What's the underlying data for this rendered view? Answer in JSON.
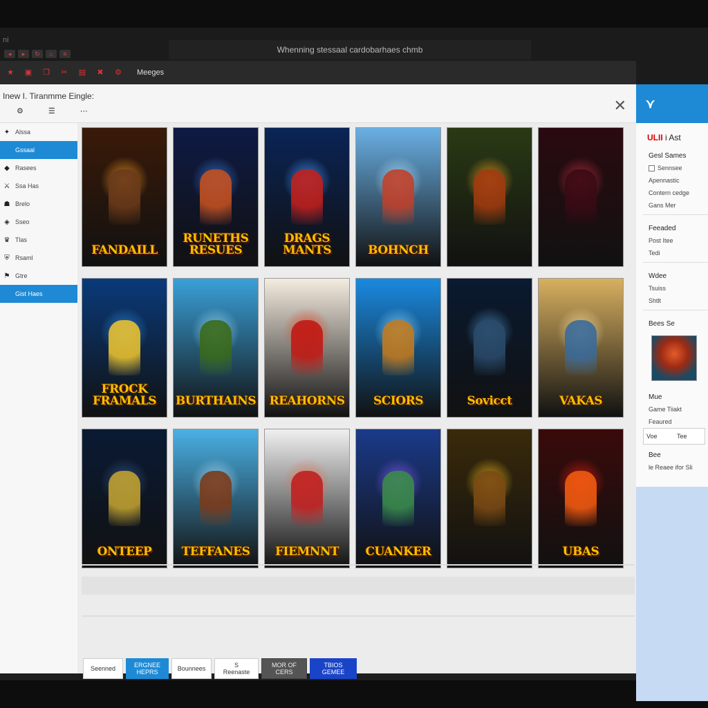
{
  "browser": {
    "url_text": "Whenning stessaal cardobarhaes chmb",
    "toolbar_label": "Meeges",
    "logo_text": "ni"
  },
  "window": {
    "title": "Inew I. Tiranmme Eingle:",
    "close_symbol": "✕"
  },
  "sidebar": {
    "items": [
      {
        "label": "Alssa",
        "icon": "star-icon",
        "glyph": "✦",
        "active": false
      },
      {
        "label": "Gssaal",
        "icon": "list-icon",
        "glyph": "",
        "active": true
      },
      {
        "label": "Rasees",
        "icon": "tag-icon",
        "glyph": "◆",
        "active": false
      },
      {
        "label": "Ssa Has",
        "icon": "sword-icon",
        "glyph": "⚔",
        "active": false
      },
      {
        "label": "Brelo",
        "icon": "ghost-icon",
        "glyph": "☗",
        "active": false
      },
      {
        "label": "Sseo",
        "icon": "gem-icon",
        "glyph": "◈",
        "active": false
      },
      {
        "label": "Tlas",
        "icon": "crown-icon",
        "glyph": "♛",
        "active": false
      },
      {
        "label": "Rsaml",
        "icon": "shield-icon",
        "glyph": "⛨",
        "active": false
      },
      {
        "label": "Gtre",
        "icon": "flag-icon",
        "glyph": "⚑",
        "active": false
      },
      {
        "label": "Gist Haes",
        "icon": "grid-icon",
        "glyph": "",
        "active": true
      }
    ]
  },
  "games": [
    {
      "title": "FANDAILL",
      "bg": "#3a1a08",
      "glow": "#f29a20",
      "hero": "#6a3a1a"
    },
    {
      "title": "RUNETHS RESUES",
      "bg": "#0e1a44",
      "glow": "#3a7adc",
      "hero": "#c25020"
    },
    {
      "title": "DRAGS MANTS",
      "bg": "#0a2456",
      "glow": "#4a9aff",
      "hero": "#c0201c"
    },
    {
      "title": "BOHNCH",
      "bg": "#6ab0e4",
      "glow": "#b0e0ff",
      "hero": "#c0402a"
    },
    {
      "title": "",
      "bg": "#2a3a14",
      "glow": "#f2a020",
      "hero": "#a03a10"
    },
    {
      "title": "",
      "bg": "#2a0a10",
      "glow": "#c03040",
      "hero": "#3a0a14"
    },
    {
      "title": "FROCK FRAMALS",
      "bg": "#0a3a7a",
      "glow": "#2a8ad8",
      "hero": "#e8c030"
    },
    {
      "title": "BURTHAINS",
      "bg": "#3aa0d8",
      "glow": "#9ad8f4",
      "hero": "#3a6a1a"
    },
    {
      "title": "REAHORNS",
      "bg": "#f4ece0",
      "glow": "#e04020",
      "hero": "#c01a14"
    },
    {
      "title": "SCIORS",
      "bg": "#1a8ae0",
      "glow": "#8ad4ff",
      "hero": "#c07a20"
    },
    {
      "title": "Sovicct",
      "bg": "#0a1a30",
      "glow": "#4a8ac0",
      "hero": "#2a4a6a"
    },
    {
      "title": "VAKAS",
      "bg": "#d8b060",
      "glow": "#f8e0a0",
      "hero": "#3a6a9a"
    },
    {
      "title": "ONTEEP",
      "bg": "#0a1a34",
      "glow": "#3a5a8a",
      "hero": "#c0a030"
    },
    {
      "title": "TEFFANES",
      "bg": "#4ab0e4",
      "glow": "#aadcf4",
      "hero": "#7a3a1a"
    },
    {
      "title": "FIEMNNT",
      "bg": "#f0f0f0",
      "glow": "#e07050",
      "hero": "#c02020"
    },
    {
      "title": "CUANKER",
      "bg": "#1a3a8a",
      "glow": "#8a5af0",
      "hero": "#3a8a4a"
    },
    {
      "title": "",
      "bg": "#3a2a0a",
      "glow": "#f2c020",
      "hero": "#7a4a14"
    },
    {
      "title": "UBAS",
      "bg": "#3a0a0a",
      "glow": "#e02010",
      "hero": "#f05a10"
    }
  ],
  "progress": {
    "fill": 0.0
  },
  "buttons": [
    {
      "label": "Seenned",
      "style": ""
    },
    {
      "label": "ERGNEE HEPRS",
      "style": "blue"
    },
    {
      "label": "Bounnees",
      "style": ""
    },
    {
      "label": "S Reenaste",
      "style": ""
    },
    {
      "label": "MOR OF CERS",
      "style": "dark"
    },
    {
      "label": "TBIOS GEMEE",
      "style": "navy"
    }
  ],
  "right_panel": {
    "header_icon": "chevron-logo-icon",
    "header_glyph": "⋎",
    "brand_red": "ULII",
    "brand_rest": " i Ast",
    "section1": "Gesl Sames",
    "check_label": "Sennsee",
    "items1": [
      "Apennastic",
      "Contern cedge",
      "Gans Mer"
    ],
    "section2": "Feeaded",
    "items2": [
      "Post Itee",
      "Tedi"
    ],
    "section3": "Wdee",
    "items3": [
      "Tsuiss",
      "Shtlt"
    ],
    "section4": "Bees Se",
    "section5": "Mue",
    "items5": [
      "Game Tiiakt",
      "Feaured"
    ],
    "tabs": [
      "Voe",
      "Tee"
    ],
    "section6": "Bee",
    "footer": "le Reaee ifor Sli"
  }
}
